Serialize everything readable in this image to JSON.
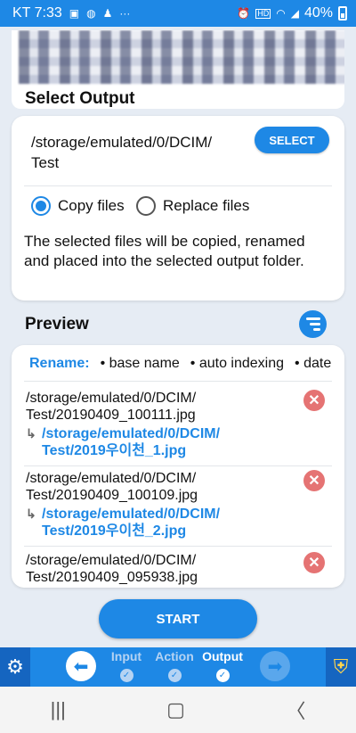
{
  "status_bar": {
    "carrier_time": "KT 7:33",
    "notification_icons": [
      "image-icon",
      "chat-icon",
      "walk-icon"
    ],
    "dots": "···",
    "system_icons": [
      "alarm-icon",
      "hd-icon",
      "wifi-icon",
      "signal-icon"
    ],
    "battery": "40%"
  },
  "select_output": {
    "title": "Select Output",
    "path_line1": "/storage/emulated/0/DCIM/",
    "path_line2": "Test",
    "select_button": "SELECT",
    "options": [
      {
        "label": "Copy files",
        "selected": true
      },
      {
        "label": "Replace files",
        "selected": false
      }
    ],
    "description": "The selected files will be copied, renamed and placed into the selected output folder."
  },
  "preview": {
    "title": "Preview",
    "rename_label": "Rename:",
    "rename_parts": [
      "• base name",
      "• auto indexing",
      "• date"
    ],
    "items": [
      {
        "src1": "/storage/emulated/0/DCIM/",
        "src2": "Test/20190409_100111.jpg",
        "dst1": "/storage/emulated/0/DCIM/",
        "dst2": "Test/2019우이천_1.jpg"
      },
      {
        "src1": "/storage/emulated/0/DCIM/",
        "src2": "Test/20190409_100109.jpg",
        "dst1": "/storage/emulated/0/DCIM/",
        "dst2": "Test/2019우이천_2.jpg"
      },
      {
        "src1": "/storage/emulated/0/DCIM/",
        "src2": "Test/20190409_095938.jpg"
      }
    ]
  },
  "start_button": "START",
  "toolbar": {
    "steps": [
      {
        "label": "Input",
        "active": false
      },
      {
        "label": "Action",
        "active": false
      },
      {
        "label": "Output",
        "active": true
      }
    ]
  },
  "colors": {
    "accent": "#1e88e5",
    "delete": "#e57373"
  }
}
